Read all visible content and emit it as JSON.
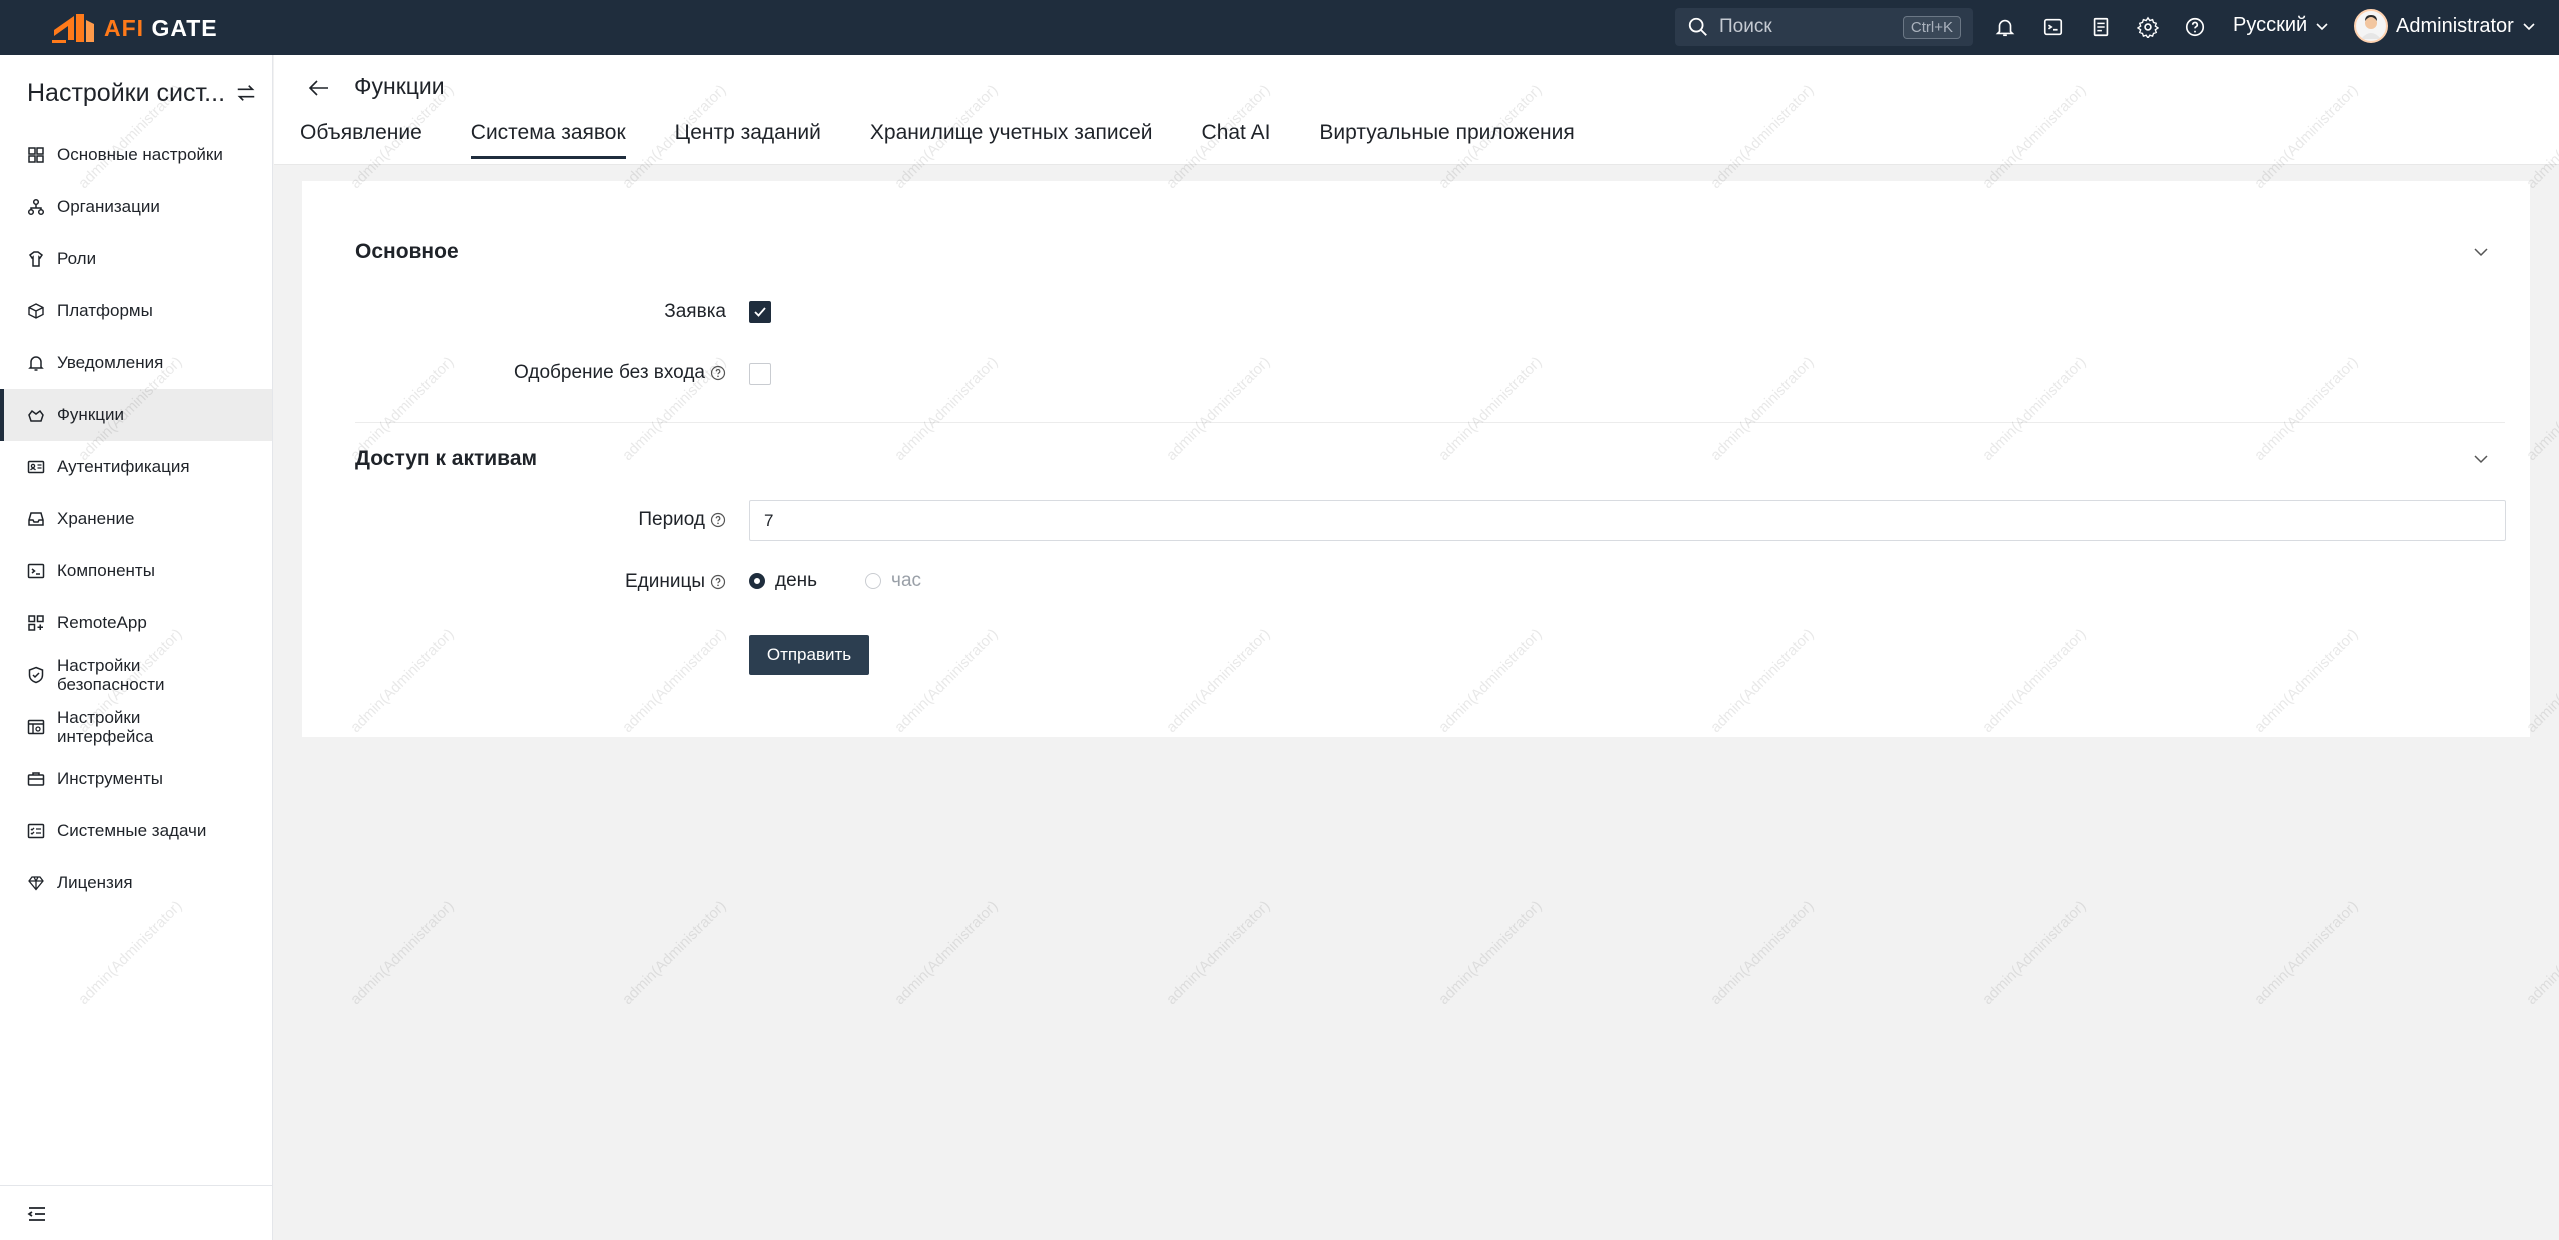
{
  "brand": {
    "name_accent": "AFI",
    "name_rest": " GATE"
  },
  "search": {
    "placeholder": "Поиск",
    "shortcut": "Ctrl+K"
  },
  "header": {
    "language": "Русский",
    "user": "Administrator"
  },
  "sidebar": {
    "title": "Настройки сист...",
    "items": [
      {
        "label": "Основные настройки",
        "icon": "grid-icon"
      },
      {
        "label": "Организации",
        "icon": "org-icon"
      },
      {
        "label": "Роли",
        "icon": "role-icon"
      },
      {
        "label": "Платформы",
        "icon": "cube-icon"
      },
      {
        "label": "Уведомления",
        "icon": "bell-icon"
      },
      {
        "label": "Функции",
        "icon": "functions-icon",
        "active": true
      },
      {
        "label": "Аутентификация",
        "icon": "id-card-icon"
      },
      {
        "label": "Хранение",
        "icon": "inbox-icon"
      },
      {
        "label": "Компоненты",
        "icon": "terminal-icon"
      },
      {
        "label": "RemoteApp",
        "icon": "apps-icon"
      },
      {
        "label": "Настройки безопасности",
        "line1": "Настройки",
        "line2": "безопасности",
        "icon": "shield-icon"
      },
      {
        "label": "Настройки интерфейса",
        "line1": "Настройки",
        "line2": "интерфейса",
        "icon": "interface-icon"
      },
      {
        "label": "Инструменты",
        "icon": "toolbox-icon"
      },
      {
        "label": "Системные задачи",
        "icon": "tasks-icon"
      },
      {
        "label": "Лицензия",
        "icon": "diamond-icon"
      }
    ]
  },
  "page": {
    "title": "Функции",
    "tabs": [
      {
        "label": "Объявление"
      },
      {
        "label": "Система заявок",
        "active": true
      },
      {
        "label": "Центр заданий"
      },
      {
        "label": "Хранилище учетных записей"
      },
      {
        "label": "Chat AI"
      },
      {
        "label": "Виртуальные приложения"
      }
    ]
  },
  "form": {
    "section_basic": "Основное",
    "ticket_label": "Заявка",
    "ticket_checked": true,
    "approve_label": "Одобрение без входа",
    "approve_checked": false,
    "section_access": "Доступ к активам",
    "period_label": "Период",
    "period_value": "7",
    "units_label": "Единицы",
    "unit_day": "день",
    "unit_hour": "час",
    "unit_selected": "день",
    "submit_label": "Отправить"
  },
  "watermark": "admin(Administrator)",
  "colors": {
    "topbar": "#1f2d3d",
    "accent": "#ff7a1a",
    "primary": "#2c3e50"
  }
}
